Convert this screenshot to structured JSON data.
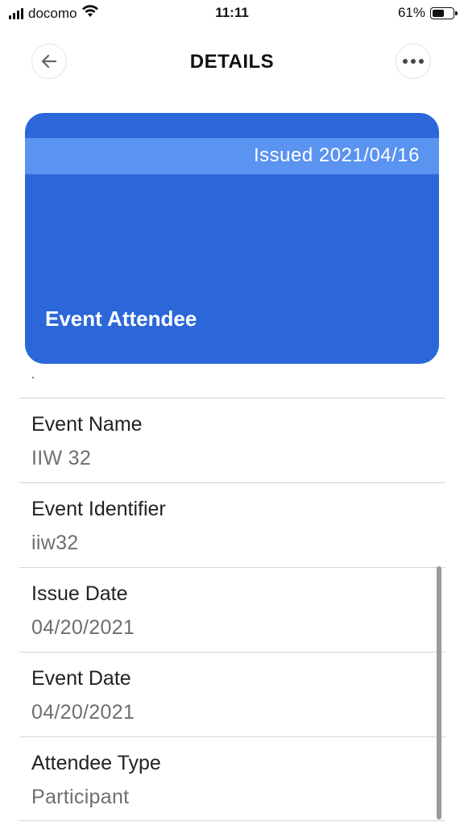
{
  "status_bar": {
    "carrier": "docomo",
    "time": "11:11",
    "battery_percent": "61%",
    "battery_level": 0.61
  },
  "header": {
    "title": "DETAILS",
    "back_icon": "arrow-left-icon",
    "more_icon": "more-horizontal-icon"
  },
  "card": {
    "issued": "Issued 2021/04/16",
    "title": "Event Attendee",
    "colors": {
      "background": "#2b67d9",
      "band": "#5a93f0"
    }
  },
  "fields": [
    {
      "label": "Event Name",
      "value": "IIW 32"
    },
    {
      "label": "Event Identifier",
      "value": "iiw32"
    },
    {
      "label": "Issue Date",
      "value": "04/20/2021"
    },
    {
      "label": "Event Date",
      "value": "04/20/2021"
    },
    {
      "label": "Attendee Type",
      "value": "Participant"
    }
  ]
}
